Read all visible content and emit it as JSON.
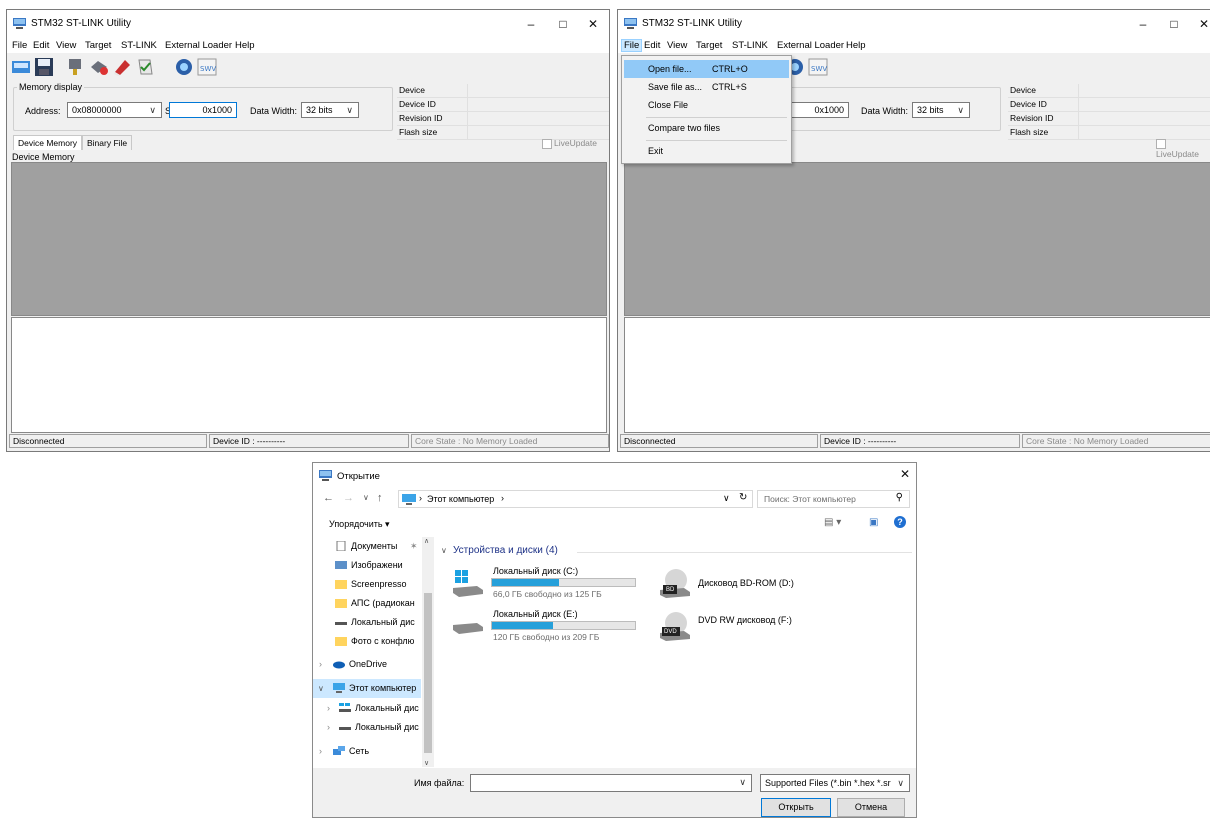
{
  "left_window": {
    "title": "STM32 ST-LINK Utility",
    "menu": [
      "File",
      "Edit",
      "View",
      "Target",
      "ST-LINK",
      "External Loader",
      "Help"
    ],
    "memory_display": {
      "group_label": "Memory display",
      "address_label": "Address:",
      "address_value": "0x08000000",
      "size_label": "Size:",
      "size_value": "0x1000",
      "data_width_label": "Data Width:",
      "data_width_value": "32 bits"
    },
    "info": [
      "Device",
      "Device ID",
      "Revision ID",
      "Flash size"
    ],
    "tabs": [
      "Device Memory",
      "Binary File"
    ],
    "live_update": "LiveUpdate",
    "memory_label": "Device Memory",
    "status": {
      "connection": "Disconnected",
      "device_id": "Device ID : ----------",
      "core_state": "Core State : No Memory Loaded"
    }
  },
  "right_window": {
    "title": "STM32 ST-LINK Utility",
    "menu": [
      "File",
      "Edit",
      "View",
      "Target",
      "ST-LINK",
      "External Loader",
      "Help"
    ],
    "size_value": "0x1000",
    "data_width_label": "Data Width:",
    "data_width_value": "32 bits",
    "info": [
      "Device",
      "Device ID",
      "Revision ID",
      "Flash size"
    ],
    "live_update": "LiveUpdate",
    "file_menu": {
      "open": "Open file...",
      "open_shortcut": "CTRL+O",
      "save": "Save file as...",
      "save_shortcut": "CTRL+S",
      "close": "Close File",
      "compare": "Compare two files",
      "exit": "Exit"
    },
    "status": {
      "connection": "Disconnected",
      "device_id": "Device ID : ----------",
      "core_state": "Core State : No Memory Loaded"
    }
  },
  "dialog": {
    "title": "Открытие",
    "path": "Этот компьютер",
    "search_placeholder": "Поиск: Этот компьютер",
    "organize": "Упорядочить ▾",
    "section": "Устройства и диски (4)",
    "tree": [
      "Документы",
      "Изображени",
      "Screenpresso",
      "АПС (радиокан",
      "Локальный дис",
      "Фото с конфлю",
      "OneDrive",
      "Этот компьютер",
      "Локальный дис",
      "Локальный дис",
      "Сеть"
    ],
    "drives": [
      {
        "name": "Локальный диск (C:)",
        "free": "66,0 ГБ свободно из 125 ГБ",
        "used_fraction": 0.47
      },
      {
        "name": "Дисковод BD-ROM (D:)"
      },
      {
        "name": "Локальный диск (E:)",
        "free": "120 ГБ свободно из 209 ГБ",
        "used_fraction": 0.43
      },
      {
        "name": "DVD RW дисковод (F:)"
      }
    ],
    "bd_label": "BD",
    "dvd_label": "DVD",
    "filename_label": "Имя файла:",
    "filter": "Supported Files (*.bin *.hex *.sr",
    "open_button": "Открыть",
    "cancel_button": "Отмена",
    "accent_color": "#26a0da"
  }
}
